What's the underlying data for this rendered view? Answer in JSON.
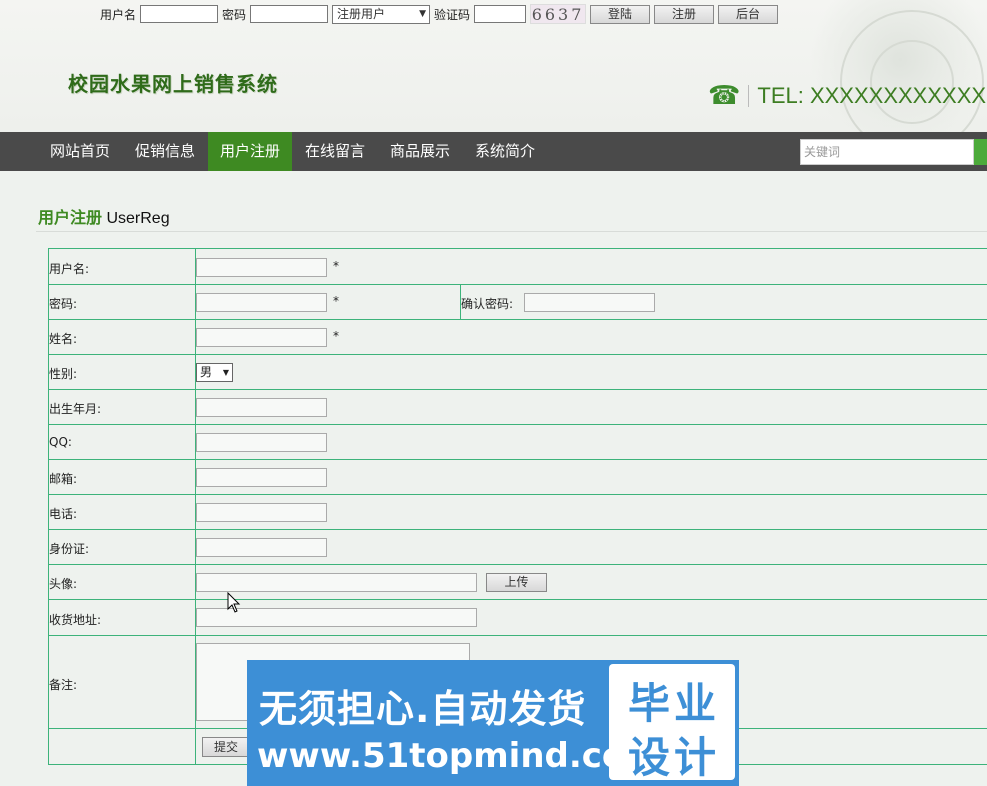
{
  "login": {
    "username_label": "用户名",
    "password_label": "密码",
    "role_selected": "注册用户",
    "captcha_label": "验证码",
    "captcha_code": "6637",
    "login_button": "登陆",
    "register_button": "注册",
    "admin_button": "后台"
  },
  "header": {
    "site_title": "校园水果网上销售系统",
    "tel": "TEL: XXXXXXXXXXXX"
  },
  "nav": {
    "items": [
      "网站首页",
      "促销信息",
      "用户注册",
      "在线留言",
      "商品展示",
      "系统简介"
    ],
    "active": "用户注册",
    "search_placeholder": "关键词"
  },
  "page": {
    "title_cn": "用户注册",
    "title_en": " UserReg"
  },
  "form": {
    "username_label": "用户名:",
    "password_label": "密码:",
    "confirm_password_label": "确认密码:",
    "name_label": "姓名:",
    "gender_label": "性别:",
    "gender_value": "男",
    "birth_label": "出生年月:",
    "qq_label": "QQ:",
    "email_label": "邮箱:",
    "phone_label": "电话:",
    "idcard_label": "身份证:",
    "avatar_label": "头像:",
    "upload_button": "上传",
    "address_label": "收货地址:",
    "remark_label": "备注:",
    "submit_button": "提交",
    "required_mark": "*"
  },
  "watermark": {
    "line1": "无须担心.自动发货",
    "line2": "www.51topmind.com",
    "box_line1": "毕业",
    "box_line2": "设计"
  },
  "colors": {
    "nav_bg": "#4a4a4a",
    "nav_active": "#3e8a22",
    "accent_green": "#3e8a22",
    "table_border": "#3cb37a",
    "watermark_blue": "#3d8fd6"
  }
}
